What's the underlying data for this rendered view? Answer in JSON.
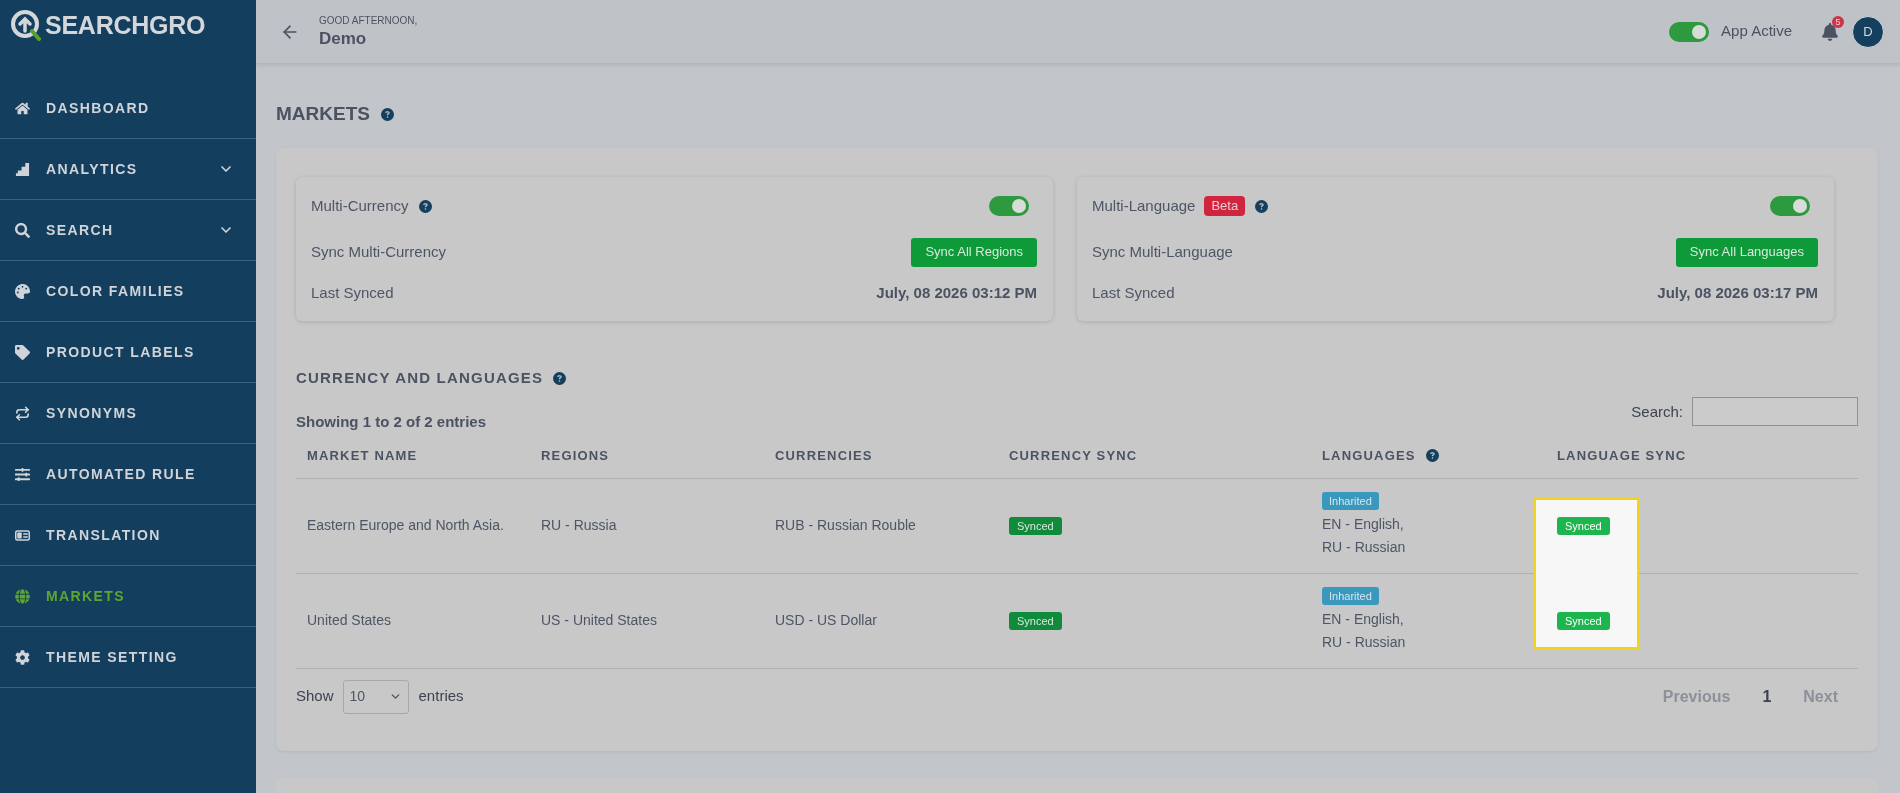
{
  "brand": {
    "name": "SEARCHGRO"
  },
  "sidebar": {
    "items": [
      {
        "label": "DASHBOARD",
        "selected": false,
        "has_submenu": false
      },
      {
        "label": "ANALYTICS",
        "selected": false,
        "has_submenu": true
      },
      {
        "label": "SEARCH",
        "selected": false,
        "has_submenu": true
      },
      {
        "label": "COLOR FAMILIES",
        "selected": false,
        "has_submenu": false
      },
      {
        "label": "PRODUCT LABELS",
        "selected": false,
        "has_submenu": false
      },
      {
        "label": "SYNONYMS",
        "selected": false,
        "has_submenu": false
      },
      {
        "label": "AUTOMATED RULE",
        "selected": false,
        "has_submenu": false
      },
      {
        "label": "TRANSLATION",
        "selected": false,
        "has_submenu": false
      },
      {
        "label": "MARKETS",
        "selected": true,
        "has_submenu": false
      },
      {
        "label": "THEME SETTING",
        "selected": false,
        "has_submenu": false
      }
    ]
  },
  "header": {
    "greeting": "GOOD AFTERNOON,",
    "user_name": "Demo",
    "app_status": {
      "label": "App Active",
      "on": true
    },
    "notifications": {
      "count": "5"
    },
    "avatar": {
      "initial": "D"
    }
  },
  "page": {
    "title": "MARKETS"
  },
  "settings_cards": [
    {
      "title": "Multi-Currency",
      "enabled": true,
      "sync_label": "Sync Multi-Currency",
      "sync_button": "Sync All Regions",
      "last_synced_label": "Last Synced",
      "last_synced": "July, 08 2026 03:12 PM"
    },
    {
      "title": "Multi-Language",
      "badge": "Beta",
      "enabled": true,
      "sync_label": "Sync Multi-Language",
      "sync_button": "Sync All Languages",
      "last_synced_label": "Last Synced",
      "last_synced": "July, 08 2026 03:17 PM"
    }
  ],
  "currency_and_languages": {
    "title": "CURRENCY AND LANGUAGES",
    "info": "Showing 1 to 2 of 2 entries",
    "search": {
      "label": "Search:"
    },
    "columns": [
      {
        "label": "MARKET NAME",
        "help": false
      },
      {
        "label": "REGIONS",
        "help": false
      },
      {
        "label": "CURRENCIES",
        "help": false
      },
      {
        "label": "CURRENCY SYNC",
        "help": false
      },
      {
        "label": "LANGUAGES",
        "help": true
      },
      {
        "label": "LANGUAGE SYNC",
        "help": false
      }
    ],
    "rows": [
      {
        "market_name": "Eastern Europe and North Asia.",
        "regions": "RU - Russia",
        "currencies": "RUB - Russian Rouble",
        "currency_sync": {
          "label": "Synced",
          "highlighted": false
        },
        "languages": {
          "badge": "Inharited",
          "lines": [
            "EN - English,",
            "RU - Russian"
          ]
        },
        "language_sync": {
          "label": "Synced",
          "highlighted": true
        }
      },
      {
        "market_name": "United States",
        "regions": "US - United States",
        "currencies": "USD - US Dollar",
        "currency_sync": {
          "label": "Synced",
          "highlighted": false
        },
        "languages": {
          "badge": "Inharited",
          "lines": [
            "EN - English,",
            "RU - Russian"
          ]
        },
        "language_sync": {
          "label": "Synced",
          "highlighted": true
        }
      }
    ],
    "footer": {
      "show_label": "Show",
      "page_size": "10",
      "entries_label": "entries",
      "previous": {
        "label": "Previous",
        "disabled": true
      },
      "pages": [
        {
          "label": "1",
          "selected": true
        }
      ],
      "next": {
        "label": "Next",
        "disabled": true
      }
    }
  }
}
